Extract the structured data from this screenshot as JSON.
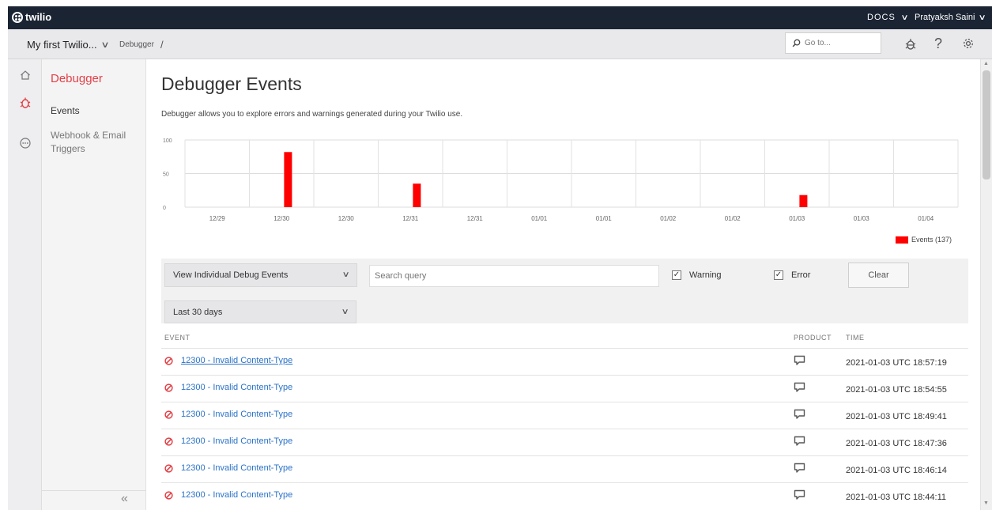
{
  "topbar": {
    "brand": "twilio",
    "docs_label": "DOCS",
    "user_name": "Pratyaksh Saini"
  },
  "subbar": {
    "project_label": "My first Twilio...",
    "crumb_page": "Debugger",
    "crumb_separator": "/",
    "goto_placeholder": "Go to..."
  },
  "nav": {
    "title": "Debugger",
    "items": [
      {
        "label": "Events"
      },
      {
        "label": "Webhook & Email Triggers"
      }
    ]
  },
  "main": {
    "title": "Debugger Events",
    "description": "Debugger allows you to explore errors and warnings generated during your Twilio use."
  },
  "chart_data": {
    "type": "bar",
    "categories": [
      "12/29",
      "12/30",
      "12/30",
      "12/31",
      "12/31",
      "01/01",
      "01/01",
      "01/02",
      "01/02",
      "01/03",
      "01/03",
      "01/04"
    ],
    "bars": [
      {
        "after_label_index": 1,
        "value": 82
      },
      {
        "after_label_index": 3,
        "value": 35
      },
      {
        "after_label_index": 9,
        "value": 18
      }
    ],
    "yticks": [
      "100",
      "50",
      "0"
    ],
    "ylim": [
      0,
      100
    ],
    "grid": true,
    "legend": "bottom-right",
    "series": [
      {
        "name": "Events (137)",
        "color": "#ff0000"
      }
    ]
  },
  "filters": {
    "view_select": "View Individual Debug Events",
    "search_placeholder": "Search query",
    "warning_label": "Warning",
    "warning_checked": true,
    "error_label": "Error",
    "error_checked": true,
    "clear_label": "Clear",
    "range_select": "Last 30 days"
  },
  "table": {
    "col_event": "EVENT",
    "col_product": "PRODUCT",
    "col_time": "TIME",
    "rows": [
      {
        "event": "12300 - Invalid Content-Type",
        "time": "2021-01-03 UTC 18:57:19"
      },
      {
        "event": "12300 - Invalid Content-Type",
        "time": "2021-01-03 UTC 18:54:55"
      },
      {
        "event": "12300 - Invalid Content-Type",
        "time": "2021-01-03 UTC 18:49:41"
      },
      {
        "event": "12300 - Invalid Content-Type",
        "time": "2021-01-03 UTC 18:47:36"
      },
      {
        "event": "12300 - Invalid Content-Type",
        "time": "2021-01-03 UTC 18:46:14"
      },
      {
        "event": "12300 - Invalid Content-Type",
        "time": "2021-01-03 UTC 18:44:11"
      }
    ]
  },
  "colors": {
    "accent": "#e23f45",
    "link": "#2a72c8",
    "topbar": "#1b2433",
    "bar": "#ff0000"
  }
}
